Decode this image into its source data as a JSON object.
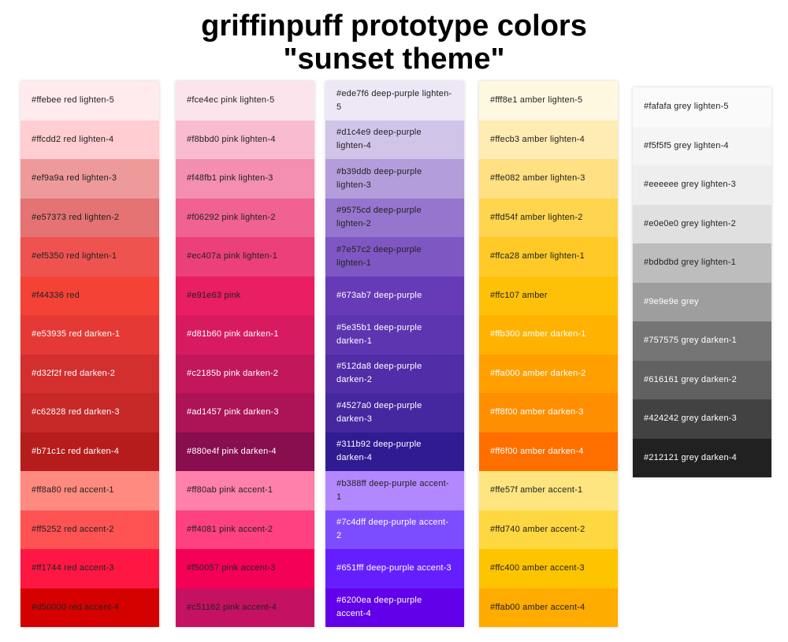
{
  "title": {
    "line1": "griffinpuff prototype colors",
    "line2": "\"sunset theme\""
  },
  "palettes": [
    {
      "name": "red",
      "swatches": [
        {
          "color": "#ffebee",
          "label": "#ffebee red lighten-5",
          "text": "dark"
        },
        {
          "color": "#ffcdd2",
          "label": "#ffcdd2 red lighten-4",
          "text": "dark"
        },
        {
          "color": "#ef9a9a",
          "label": "#ef9a9a red lighten-3",
          "text": "dark"
        },
        {
          "color": "#e57373",
          "label": "#e57373 red lighten-2",
          "text": "dark"
        },
        {
          "color": "#ef5350",
          "label": "#ef5350 red lighten-1",
          "text": "dark"
        },
        {
          "color": "#f44336",
          "label": "#f44336 red",
          "text": "dark"
        },
        {
          "color": "#e53935",
          "label": "#e53935 red darken-1",
          "text": "light"
        },
        {
          "color": "#d32f2f",
          "label": "#d32f2f red darken-2",
          "text": "light"
        },
        {
          "color": "#c62828",
          "label": "#c62828 red darken-3",
          "text": "light"
        },
        {
          "color": "#b71c1c",
          "label": "#b71c1c red darken-4",
          "text": "light"
        },
        {
          "color": "#ff8a80",
          "label": "#ff8a80 red accent-1",
          "text": "dark"
        },
        {
          "color": "#ff5252",
          "label": "#ff5252 red accent-2",
          "text": "dark"
        },
        {
          "color": "#ff1744",
          "label": "#ff1744 red accent-3",
          "text": "dark"
        },
        {
          "color": "#d50000",
          "label": "#d50000 red accent-4",
          "text": "dark"
        }
      ]
    },
    {
      "name": "pink",
      "swatches": [
        {
          "color": "#fce4ec",
          "label": "#fce4ec pink lighten-5",
          "text": "dark"
        },
        {
          "color": "#f8bbd0",
          "label": "#f8bbd0 pink lighten-4",
          "text": "dark"
        },
        {
          "color": "#f48fb1",
          "label": "#f48fb1 pink lighten-3",
          "text": "dark"
        },
        {
          "color": "#f06292",
          "label": "#f06292 pink lighten-2",
          "text": "dark"
        },
        {
          "color": "#ec407a",
          "label": "#ec407a pink lighten-1",
          "text": "dark"
        },
        {
          "color": "#e91e63",
          "label": "#e91e63 pink",
          "text": "dark"
        },
        {
          "color": "#d81b60",
          "label": "#d81b60 pink darken-1",
          "text": "light"
        },
        {
          "color": "#c2185b",
          "label": "#c2185b pink darken-2",
          "text": "light"
        },
        {
          "color": "#ad1457",
          "label": "#ad1457 pink darken-3",
          "text": "light"
        },
        {
          "color": "#880e4f",
          "label": "#880e4f pink darken-4",
          "text": "light"
        },
        {
          "color": "#ff80ab",
          "label": "#ff80ab pink accent-1",
          "text": "dark"
        },
        {
          "color": "#ff4081",
          "label": "#ff4081 pink accent-2",
          "text": "dark"
        },
        {
          "color": "#f50057",
          "label": "#f50057 pink accent-3",
          "text": "dark"
        },
        {
          "color": "#c51162",
          "label": "#c51162 pink accent-4",
          "text": "dark"
        }
      ]
    },
    {
      "name": "deep-purple",
      "swatches": [
        {
          "color": "#ede7f6",
          "label": "#ede7f6 deep-purple lighten-5",
          "text": "dark"
        },
        {
          "color": "#d1c4e9",
          "label": "#d1c4e9 deep-purple lighten-4",
          "text": "dark"
        },
        {
          "color": "#b39ddb",
          "label": "#b39ddb deep-purple lighten-3",
          "text": "dark"
        },
        {
          "color": "#9575cd",
          "label": "#9575cd deep-purple lighten-2",
          "text": "dark"
        },
        {
          "color": "#7e57c2",
          "label": "#7e57c2 deep-purple lighten-1",
          "text": "dark"
        },
        {
          "color": "#673ab7",
          "label": "#673ab7 deep-purple",
          "text": "light"
        },
        {
          "color": "#5e35b1",
          "label": "#5e35b1 deep-purple darken-1",
          "text": "light"
        },
        {
          "color": "#512da8",
          "label": "#512da8 deep-purple darken-2",
          "text": "light"
        },
        {
          "color": "#4527a0",
          "label": "#4527a0 deep-purple darken-3",
          "text": "light"
        },
        {
          "color": "#311b92",
          "label": "#311b92 deep-purple darken-4",
          "text": "light"
        },
        {
          "color": "#b388ff",
          "label": "#b388ff deep-purple accent-1",
          "text": "dark"
        },
        {
          "color": "#7c4dff",
          "label": "#7c4dff deep-purple accent-2",
          "text": "light"
        },
        {
          "color": "#651fff",
          "label": "#651fff deep-purple accent-3",
          "text": "light"
        },
        {
          "color": "#6200ea",
          "label": "#6200ea deep-purple accent-4",
          "text": "light"
        }
      ]
    },
    {
      "name": "amber",
      "swatches": [
        {
          "color": "#fff8e1",
          "label": "#fff8e1 amber lighten-5",
          "text": "dark"
        },
        {
          "color": "#ffecb3",
          "label": "#ffecb3 amber lighten-4",
          "text": "dark"
        },
        {
          "color": "#ffe082",
          "label": "#ffe082 amber lighten-3",
          "text": "dark"
        },
        {
          "color": "#ffd54f",
          "label": "#ffd54f amber lighten-2",
          "text": "dark"
        },
        {
          "color": "#ffca28",
          "label": "#ffca28 amber lighten-1",
          "text": "dark"
        },
        {
          "color": "#ffc107",
          "label": "#ffc107 amber",
          "text": "dark"
        },
        {
          "color": "#ffb300",
          "label": "#ffb300 amber darken-1",
          "text": "light"
        },
        {
          "color": "#ffa000",
          "label": "#ffa000 amber darken-2",
          "text": "light"
        },
        {
          "color": "#ff8f00",
          "label": "#ff8f00 amber darken-3",
          "text": "light"
        },
        {
          "color": "#ff6f00",
          "label": "#ff6f00 amber darken-4",
          "text": "light"
        },
        {
          "color": "#ffe57f",
          "label": "#ffe57f amber accent-1",
          "text": "dark"
        },
        {
          "color": "#ffd740",
          "label": "#ffd740 amber accent-2",
          "text": "dark"
        },
        {
          "color": "#ffc400",
          "label": "#ffc400 amber accent-3",
          "text": "dark"
        },
        {
          "color": "#ffab00",
          "label": "#ffab00 amber accent-4",
          "text": "dark"
        }
      ]
    },
    {
      "name": "grey",
      "swatches": [
        {
          "color": "#fafafa",
          "label": "#fafafa grey lighten-5",
          "text": "dark"
        },
        {
          "color": "#f5f5f5",
          "label": "#f5f5f5 grey lighten-4",
          "text": "dark"
        },
        {
          "color": "#eeeeee",
          "label": "#eeeeee grey lighten-3",
          "text": "dark"
        },
        {
          "color": "#e0e0e0",
          "label": "#e0e0e0 grey lighten-2",
          "text": "dark"
        },
        {
          "color": "#bdbdbd",
          "label": "#bdbdbd grey lighten-1",
          "text": "dark"
        },
        {
          "color": "#9e9e9e",
          "label": "#9e9e9e grey",
          "text": "light"
        },
        {
          "color": "#757575",
          "label": "#757575 grey darken-1",
          "text": "light"
        },
        {
          "color": "#616161",
          "label": "#616161 grey darken-2",
          "text": "light"
        },
        {
          "color": "#424242",
          "label": "#424242 grey darken-3",
          "text": "light"
        },
        {
          "color": "#212121",
          "label": "#212121 grey darken-4",
          "text": "light"
        }
      ]
    }
  ]
}
